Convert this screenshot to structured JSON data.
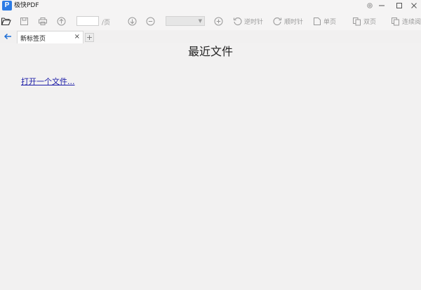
{
  "app": {
    "title": "极快PDF",
    "logo_letter": "P",
    "logo_icon": "pdf-logo-icon"
  },
  "window_controls": {
    "settings_icon": "gear-icon",
    "minimize_icon": "minimize-icon",
    "maximize_icon": "maximize-icon",
    "close_icon": "close-icon"
  },
  "toolbar": {
    "page_input_value": "",
    "page_suffix": "/页",
    "zoom_value": "",
    "rotate_ccw_label": "逆时针",
    "rotate_cw_label": "顺时针",
    "single_page_label": "单页",
    "double_page_label": "双页",
    "continuous_label": "连续阅"
  },
  "tabs": {
    "items": [
      {
        "label": "新标签页",
        "close": "×"
      }
    ],
    "add_label": "+"
  },
  "main": {
    "title": "最近文件",
    "open_link": "打开一个文件..."
  },
  "colors": {
    "link": "#1a1aa6",
    "accent": "#1e6ed6",
    "background": "#f2f1f1"
  }
}
